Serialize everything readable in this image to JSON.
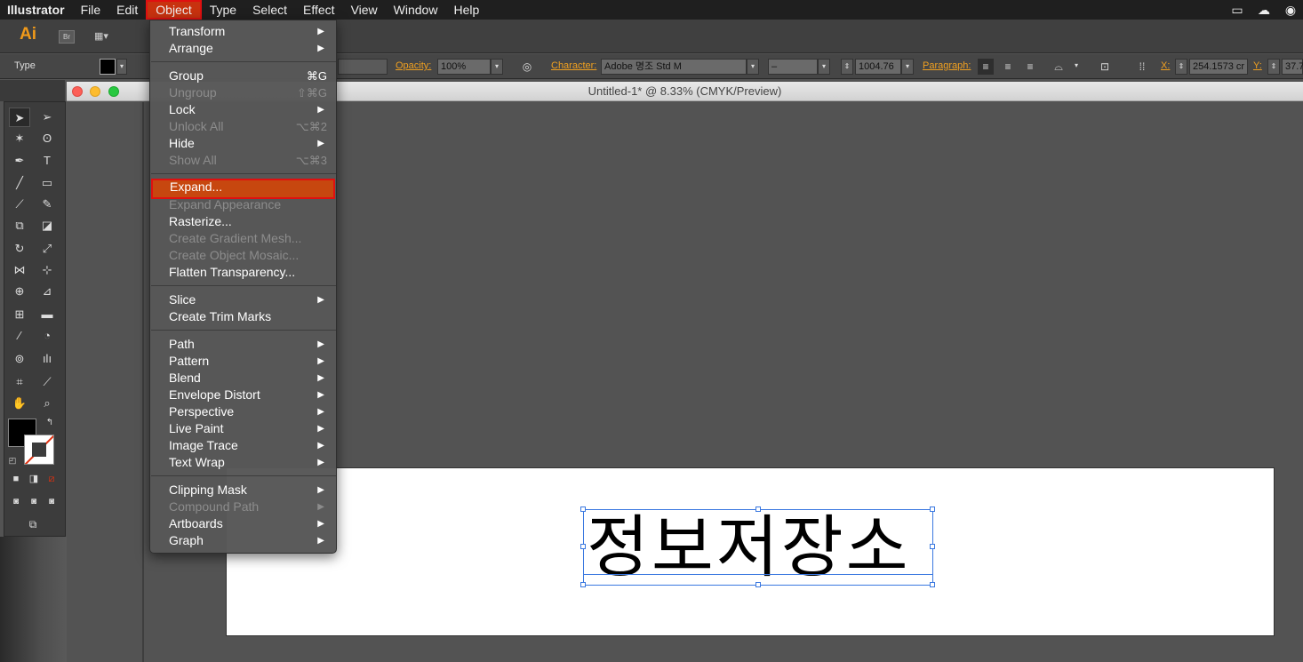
{
  "menubar": {
    "app": "Illustrator",
    "items": [
      "File",
      "Edit",
      "Object",
      "Type",
      "Select",
      "Effect",
      "View",
      "Window",
      "Help"
    ],
    "active": "Object"
  },
  "appbar": {
    "logo": "Ai",
    "bridge": "Br"
  },
  "control_bar": {
    "selection_label": "Type",
    "opacity_label": "Opacity:",
    "opacity_value": "100%",
    "character_label": "Character:",
    "font_name": "Adobe 명조 Std M",
    "font_style": "–",
    "font_size": "1004.76",
    "paragraph_label": "Paragraph:",
    "x_label": "X:",
    "x_value": "254.1573 cr",
    "y_label": "Y:",
    "y_value": "37.7"
  },
  "document": {
    "title": "Untitled-1* @ 8.33% (CMYK/Preview)",
    "text_content": "정보저장소"
  },
  "object_menu": {
    "transform": "Transform",
    "arrange": "Arrange",
    "group": "Group",
    "group_sc": "⌘G",
    "ungroup": "Ungroup",
    "ungroup_sc": "⇧⌘G",
    "lock": "Lock",
    "unlock_all": "Unlock All",
    "unlock_all_sc": "⌥⌘2",
    "hide": "Hide",
    "show_all": "Show All",
    "show_all_sc": "⌥⌘3",
    "expand": "Expand...",
    "expand_appearance": "Expand Appearance",
    "rasterize": "Rasterize...",
    "create_gradient_mesh": "Create Gradient Mesh...",
    "create_object_mosaic": "Create Object Mosaic...",
    "flatten_transparency": "Flatten Transparency...",
    "slice": "Slice",
    "create_trim_marks": "Create Trim Marks",
    "path": "Path",
    "pattern": "Pattern",
    "blend": "Blend",
    "envelope_distort": "Envelope Distort",
    "perspective": "Perspective",
    "live_paint": "Live Paint",
    "image_trace": "Image Trace",
    "text_wrap": "Text Wrap",
    "clipping_mask": "Clipping Mask",
    "compound_path": "Compound Path",
    "artboards": "Artboards",
    "graph": "Graph"
  }
}
